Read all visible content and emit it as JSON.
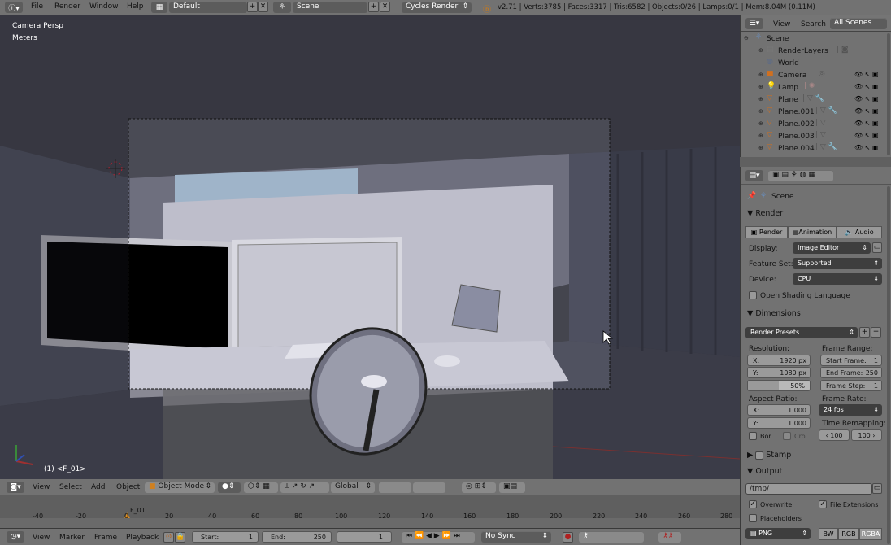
{
  "topbar": {
    "menus": [
      "File",
      "Render",
      "Window",
      "Help"
    ],
    "screen_layout": "Default",
    "scene": "Scene",
    "engine": "Cycles Render",
    "stats": "v2.71 | Verts:3785 | Faces:3317 | Tris:6582 | Objects:0/26 | Lamps:0/1 | Mem:8.04M (0.11M)"
  },
  "viewport": {
    "view_label": "Camera Persp",
    "units_label": "Meters",
    "object_label": "(1) <F_01>"
  },
  "viewport_header": {
    "menus": [
      "View",
      "Select",
      "Add",
      "Object"
    ],
    "mode": "Object Mode",
    "orientation": "Global"
  },
  "outliner": {
    "menus": [
      "View",
      "Search"
    ],
    "filter": "All Scenes",
    "items": [
      {
        "label": "Scene",
        "indent": 0
      },
      {
        "label": "RenderLayers",
        "indent": 1
      },
      {
        "label": "World",
        "indent": 1
      },
      {
        "label": "Camera",
        "indent": 1
      },
      {
        "label": "Lamp",
        "indent": 1
      },
      {
        "label": "Plane",
        "indent": 1
      },
      {
        "label": "Plane.001",
        "indent": 1
      },
      {
        "label": "Plane.002",
        "indent": 1
      },
      {
        "label": "Plane.003",
        "indent": 1
      },
      {
        "label": "Plane.004",
        "indent": 1
      }
    ]
  },
  "properties": {
    "context": "Scene",
    "render_panel": {
      "title": "Render",
      "buttons": [
        "Render",
        "Animation",
        "Audio"
      ],
      "display_label": "Display:",
      "display_value": "Image Editor",
      "feature_label": "Feature Set:",
      "feature_value": "Supported",
      "device_label": "Device:",
      "device_value": "CPU",
      "osl_label": "Open Shading Language"
    },
    "dimensions_panel": {
      "title": "Dimensions",
      "presets": "Render Presets",
      "resolution_label": "Resolution:",
      "res_x": "X:",
      "res_x_val": "1920 px",
      "res_y": "Y:",
      "res_y_val": "1080 px",
      "res_pct": "50%",
      "frame_range_label": "Frame Range:",
      "start_frame": "Start Frame:",
      "start_frame_val": "1",
      "end_frame": "End Frame:",
      "end_frame_val": "250",
      "frame_step": "Frame Step:",
      "frame_step_val": "1",
      "aspect_label": "Aspect Ratio:",
      "asp_x": "X:",
      "asp_x_val": "1.000",
      "asp_y": "Y:",
      "asp_y_val": "1.000",
      "frame_rate_label": "Frame Rate:",
      "fps": "24 fps",
      "remap_label": "Time Remapping:",
      "remap_old": "100",
      "remap_new": "100",
      "border": "Bor",
      "crop": "Cro"
    },
    "stamp_title": "Stamp",
    "output_panel": {
      "title": "Output",
      "path": "/tmp/",
      "overwrite": "Overwrite",
      "file_ext": "File Extensions",
      "placeholders": "Placeholders",
      "format": "PNG",
      "bw": "BW",
      "rgb": "RGB",
      "rgba": "RGBA"
    }
  },
  "timeline": {
    "marker": "F_01",
    "ticks": [
      "-40",
      "-20",
      "0",
      "20",
      "40",
      "60",
      "80",
      "100",
      "120",
      "140",
      "160",
      "180",
      "200",
      "220",
      "240",
      "260",
      "280"
    ]
  },
  "timeline_header": {
    "menus": [
      "View",
      "Marker",
      "Frame",
      "Playback"
    ],
    "start_label": "Start:",
    "start_val": "1",
    "end_label": "End:",
    "end_val": "250",
    "current": "1",
    "sync": "No Sync"
  }
}
